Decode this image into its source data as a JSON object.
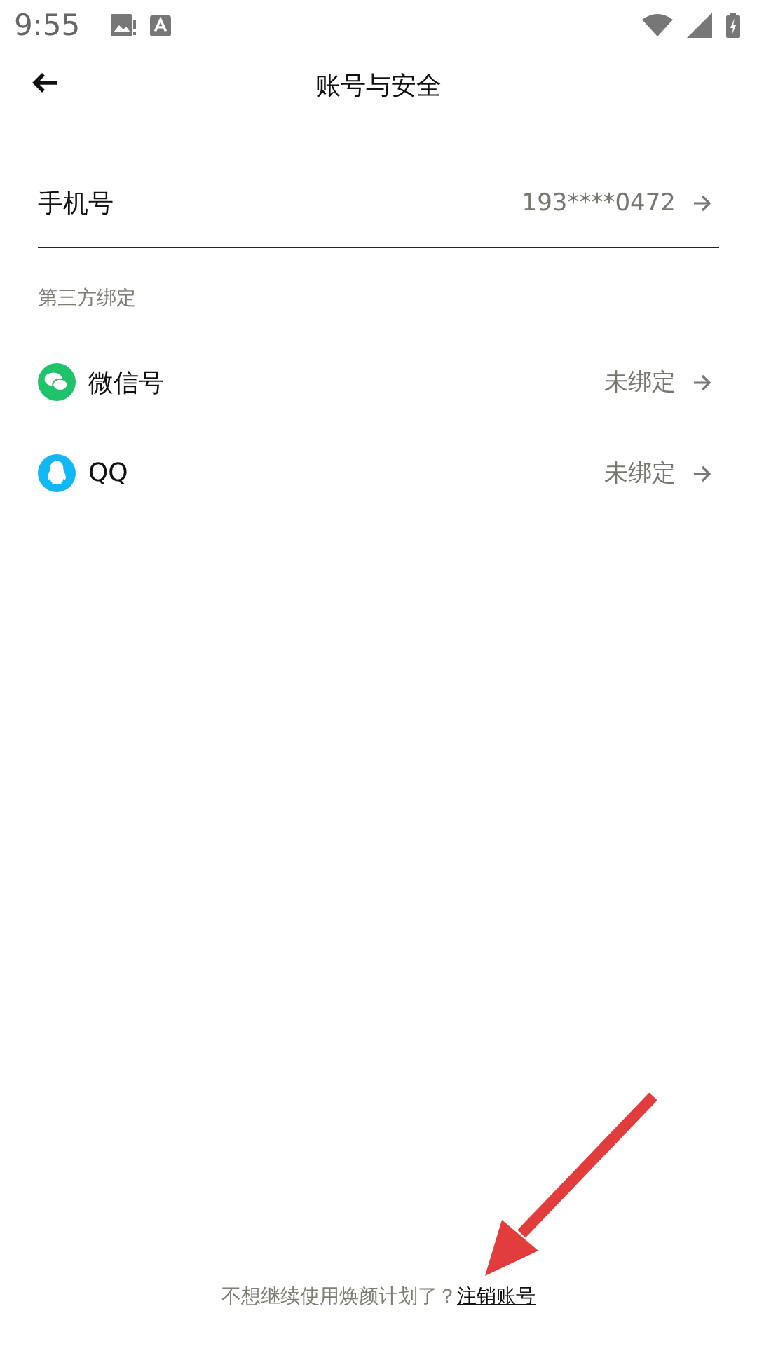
{
  "status_bar": {
    "time": "9:55"
  },
  "header": {
    "title": "账号与安全"
  },
  "phone": {
    "label": "手机号",
    "value": "193****0472"
  },
  "third_party": {
    "heading": "第三方绑定",
    "items": [
      {
        "kind": "wechat",
        "label": "微信号",
        "status": "未绑定"
      },
      {
        "kind": "qq",
        "label": "QQ",
        "status": "未绑定"
      }
    ]
  },
  "footer": {
    "text": "不想继续使用焕颜计划了？",
    "link": "注销账号"
  }
}
